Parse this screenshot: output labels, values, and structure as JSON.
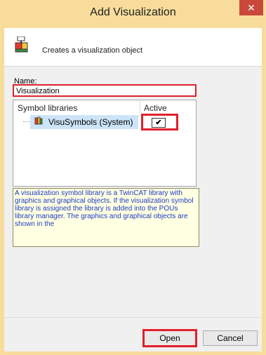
{
  "window": {
    "title": "Add Visualization",
    "close_glyph": "✕"
  },
  "header": {
    "description": "Creates a visualization object",
    "icon": "visualization-object-icon"
  },
  "form": {
    "name_label": "Name:",
    "name_value": "Visualization"
  },
  "libraries": {
    "columns": [
      "Symbol libraries",
      "Active"
    ],
    "rows": [
      {
        "name": "VisuSymbols (System)",
        "active": true,
        "icon": "library-icon"
      }
    ]
  },
  "tooltip": {
    "text": "A visualization symbol library is a TwinCAT library with graphics and graphical objects. If the visualization symbol library is assigned the library is added into the POUs library manager. The graphics and graphical objects are shown in the"
  },
  "buttons": {
    "open": "Open",
    "cancel": "Cancel"
  },
  "colors": {
    "title_bar": "#f7dc9b",
    "highlight": "#e0202b",
    "close_button": "#c9483b",
    "tooltip_bg": "#ffffe1",
    "tooltip_text": "#1f3cc8"
  }
}
